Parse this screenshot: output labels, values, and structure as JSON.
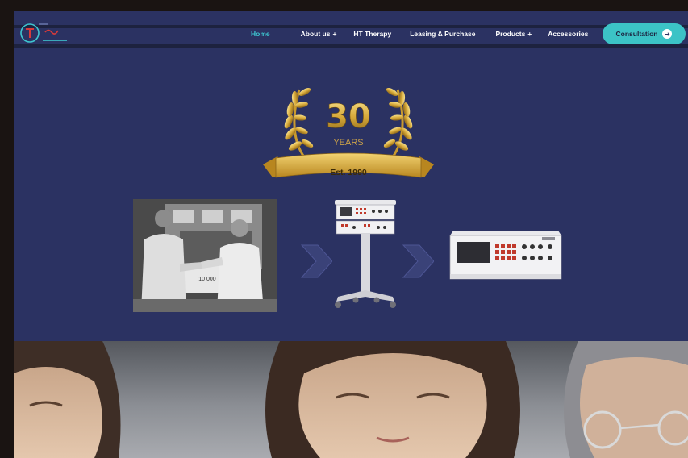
{
  "nav": {
    "links": [
      {
        "label": "Home",
        "active": true
      },
      {
        "label": "About us",
        "submenu": "+"
      },
      {
        "label": "HT Therapy"
      },
      {
        "label": "Leasing & Purchase"
      },
      {
        "label": "Products",
        "submenu": "+"
      },
      {
        "label": "Accessories"
      }
    ],
    "cta_label": "Consultation",
    "cta_icon": "arrow-right-icon"
  },
  "anniversary": {
    "number": "30",
    "years_label": "YEARS",
    "established": "Est. 1990"
  },
  "history_strip": {
    "photo_caption": "10 000"
  },
  "colors": {
    "background": "#2b3262",
    "accent": "#3cc3c6",
    "active_link": "#3ec6d0",
    "gold": "#d7a93a"
  }
}
